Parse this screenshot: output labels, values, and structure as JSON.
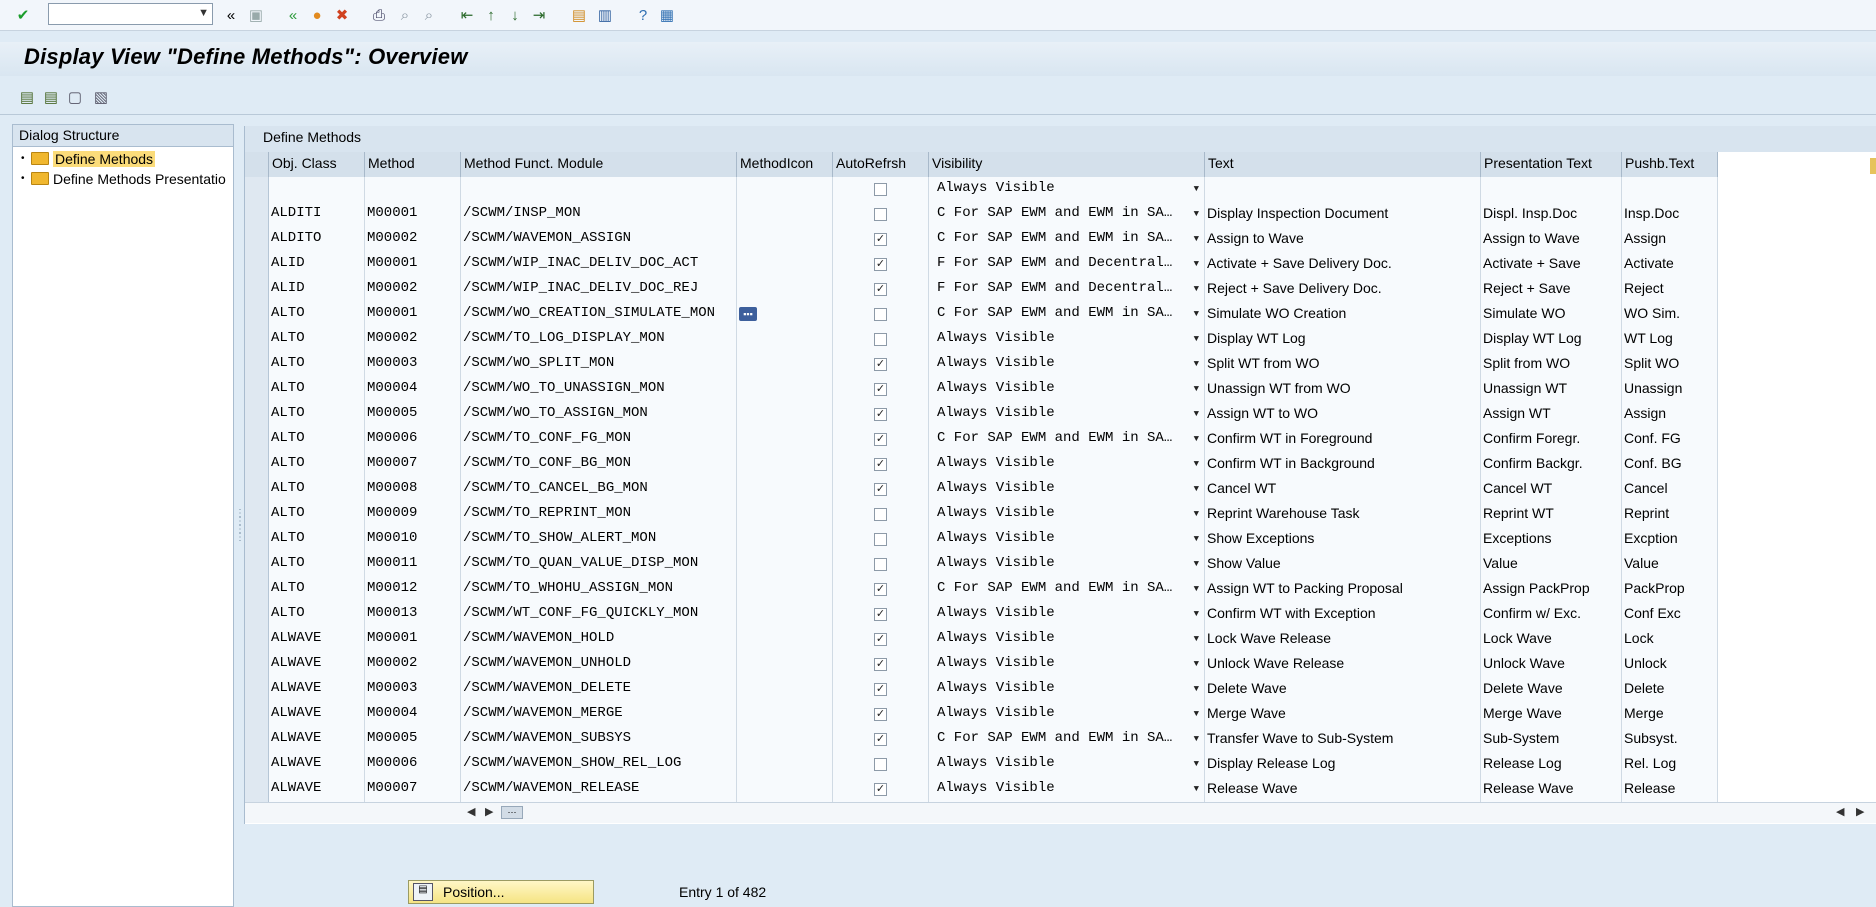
{
  "toolbar": {
    "command_field_value": "",
    "icons": [
      "check-icon",
      "command-dropdown",
      "expand-arrows-icon",
      "save-icon",
      "back-icon",
      "exit-icon",
      "cancel-icon",
      "print-icon",
      "find-icon",
      "find-next-icon",
      "first-page-icon",
      "previous-page-icon",
      "next-page-icon",
      "last-page-icon",
      "create-session-icon",
      "shortcut-icon",
      "help-icon",
      "layout-icon"
    ],
    "expand_glyph": "«"
  },
  "title": "Display View \"Define Methods\": Overview",
  "left_pane": {
    "header": "Dialog Structure",
    "items": [
      {
        "label": "Define Methods",
        "selected": true
      },
      {
        "label": "Define Methods Presentatio",
        "selected": false
      }
    ]
  },
  "table": {
    "caption": "Define Methods",
    "headers": [
      "Obj. Class",
      "Method",
      "Method Funct. Module",
      "MethodIcon",
      "AutoRefrsh",
      "Visibility",
      "Text",
      "Presentation Text",
      "Pushb.Text"
    ],
    "rows": [
      {
        "obj": "",
        "method": "",
        "fm": "",
        "icon": false,
        "auto": false,
        "vis": "Always Visible",
        "text": "",
        "pres": "",
        "push": ""
      },
      {
        "obj": "ALDITI",
        "method": "M00001",
        "fm": "/SCWM/INSP_MON",
        "icon": false,
        "auto": false,
        "vis": "C For SAP EWM and EWM in SA…",
        "text": "Display Inspection Document",
        "pres": "Displ. Insp.Doc",
        "push": "Insp.Doc"
      },
      {
        "obj": "ALDITO",
        "method": "M00002",
        "fm": "/SCWM/WAVEMON_ASSIGN",
        "icon": false,
        "auto": true,
        "vis": "C For SAP EWM and EWM in SA…",
        "text": "Assign to Wave",
        "pres": "Assign to Wave",
        "push": "Assign"
      },
      {
        "obj": "ALID",
        "method": "M00001",
        "fm": "/SCWM/WIP_INAC_DELIV_DOC_ACT",
        "icon": false,
        "auto": true,
        "vis": "F For SAP EWM and Decentral…",
        "text": "Activate + Save Delivery Doc.",
        "pres": "Activate + Save",
        "push": "Activate"
      },
      {
        "obj": "ALID",
        "method": "M00002",
        "fm": "/SCWM/WIP_INAC_DELIV_DOC_REJ",
        "icon": false,
        "auto": true,
        "vis": "F For SAP EWM and Decentral…",
        "text": "Reject + Save Delivery Doc.",
        "pres": "Reject + Save",
        "push": "Reject"
      },
      {
        "obj": "ALTO",
        "method": "M00001",
        "fm": "/SCWM/WO_CREATION_SIMULATE_MON",
        "icon": true,
        "auto": false,
        "vis": "C For SAP EWM and EWM in SA…",
        "text": "Simulate WO Creation",
        "pres": "Simulate WO",
        "push": "WO Sim."
      },
      {
        "obj": "ALTO",
        "method": "M00002",
        "fm": "/SCWM/TO_LOG_DISPLAY_MON",
        "icon": false,
        "auto": false,
        "vis": "Always Visible",
        "text": "Display WT Log",
        "pres": "Display WT Log",
        "push": "WT Log"
      },
      {
        "obj": "ALTO",
        "method": "M00003",
        "fm": "/SCWM/WO_SPLIT_MON",
        "icon": false,
        "auto": true,
        "vis": "Always Visible",
        "text": "Split WT from WO",
        "pres": "Split from WO",
        "push": "Split WO"
      },
      {
        "obj": "ALTO",
        "method": "M00004",
        "fm": "/SCWM/WO_TO_UNASSIGN_MON",
        "icon": false,
        "auto": true,
        "vis": "Always Visible",
        "text": "Unassign WT from WO",
        "pres": "Unassign WT",
        "push": "Unassign"
      },
      {
        "obj": "ALTO",
        "method": "M00005",
        "fm": "/SCWM/WO_TO_ASSIGN_MON",
        "icon": false,
        "auto": true,
        "vis": "Always Visible",
        "text": "Assign WT to WO",
        "pres": "Assign WT",
        "push": "Assign"
      },
      {
        "obj": "ALTO",
        "method": "M00006",
        "fm": "/SCWM/TO_CONF_FG_MON",
        "icon": false,
        "auto": true,
        "vis": "C For SAP EWM and EWM in SA…",
        "text": "Confirm WT in Foreground",
        "pres": "Confirm Foregr.",
        "push": "Conf. FG"
      },
      {
        "obj": "ALTO",
        "method": "M00007",
        "fm": "/SCWM/TO_CONF_BG_MON",
        "icon": false,
        "auto": true,
        "vis": "Always Visible",
        "text": "Confirm WT in Background",
        "pres": "Confirm Backgr.",
        "push": "Conf. BG"
      },
      {
        "obj": "ALTO",
        "method": "M00008",
        "fm": "/SCWM/TO_CANCEL_BG_MON",
        "icon": false,
        "auto": true,
        "vis": "Always Visible",
        "text": "Cancel WT",
        "pres": "Cancel WT",
        "push": "Cancel"
      },
      {
        "obj": "ALTO",
        "method": "M00009",
        "fm": "/SCWM/TO_REPRINT_MON",
        "icon": false,
        "auto": false,
        "vis": "Always Visible",
        "text": "Reprint Warehouse Task",
        "pres": "Reprint WT",
        "push": "Reprint"
      },
      {
        "obj": "ALTO",
        "method": "M00010",
        "fm": "/SCWM/TO_SHOW_ALERT_MON",
        "icon": false,
        "auto": false,
        "vis": "Always Visible",
        "text": "Show Exceptions",
        "pres": "Exceptions",
        "push": "Excption"
      },
      {
        "obj": "ALTO",
        "method": "M00011",
        "fm": "/SCWM/TO_QUAN_VALUE_DISP_MON",
        "icon": false,
        "auto": false,
        "vis": "Always Visible",
        "text": "Show Value",
        "pres": "Value",
        "push": "Value"
      },
      {
        "obj": "ALTO",
        "method": "M00012",
        "fm": "/SCWM/TO_WHOHU_ASSIGN_MON",
        "icon": false,
        "auto": true,
        "vis": "C For SAP EWM and EWM in SA…",
        "text": "Assign WT to Packing Proposal",
        "pres": "Assign PackProp",
        "push": "PackProp"
      },
      {
        "obj": "ALTO",
        "method": "M00013",
        "fm": "/SCWM/WT_CONF_FG_QUICKLY_MON",
        "icon": false,
        "auto": true,
        "vis": "Always Visible",
        "text": "Confirm WT with Exception",
        "pres": "Confirm w/ Exc.",
        "push": "Conf Exc"
      },
      {
        "obj": "ALWAVE",
        "method": "M00001",
        "fm": "/SCWM/WAVEMON_HOLD",
        "icon": false,
        "auto": true,
        "vis": "Always Visible",
        "text": "Lock Wave Release",
        "pres": "Lock Wave",
        "push": "Lock"
      },
      {
        "obj": "ALWAVE",
        "method": "M00002",
        "fm": "/SCWM/WAVEMON_UNHOLD",
        "icon": false,
        "auto": true,
        "vis": "Always Visible",
        "text": "Unlock Wave Release",
        "pres": "Unlock Wave",
        "push": "Unlock"
      },
      {
        "obj": "ALWAVE",
        "method": "M00003",
        "fm": "/SCWM/WAVEMON_DELETE",
        "icon": false,
        "auto": true,
        "vis": "Always Visible",
        "text": "Delete Wave",
        "pres": "Delete Wave",
        "push": "Delete"
      },
      {
        "obj": "ALWAVE",
        "method": "M00004",
        "fm": "/SCWM/WAVEMON_MERGE",
        "icon": false,
        "auto": true,
        "vis": "Always Visible",
        "text": "Merge Wave",
        "pres": "Merge Wave",
        "push": "Merge"
      },
      {
        "obj": "ALWAVE",
        "method": "M00005",
        "fm": "/SCWM/WAVEMON_SUBSYS",
        "icon": false,
        "auto": true,
        "vis": "C For SAP EWM and EWM in SA…",
        "text": "Transfer Wave to Sub-System",
        "pres": "Sub-System",
        "push": "Subsyst."
      },
      {
        "obj": "ALWAVE",
        "method": "M00006",
        "fm": "/SCWM/WAVEMON_SHOW_REL_LOG",
        "icon": false,
        "auto": false,
        "vis": "Always Visible",
        "text": "Display Release Log",
        "pres": "Release Log",
        "push": "Rel. Log"
      },
      {
        "obj": "ALWAVE",
        "method": "M00007",
        "fm": "/SCWM/WAVEMON_RELEASE",
        "icon": false,
        "auto": true,
        "vis": "Always Visible",
        "text": "Release Wave",
        "pres": "Release Wave",
        "push": "Release"
      }
    ]
  },
  "footer": {
    "position_button": "Position...",
    "entry_info": "Entry 1 of 482"
  },
  "colors": {
    "background": "#dfebf5",
    "selected_tree_item": "#fbdc7a",
    "position_button": "#f5e483"
  }
}
